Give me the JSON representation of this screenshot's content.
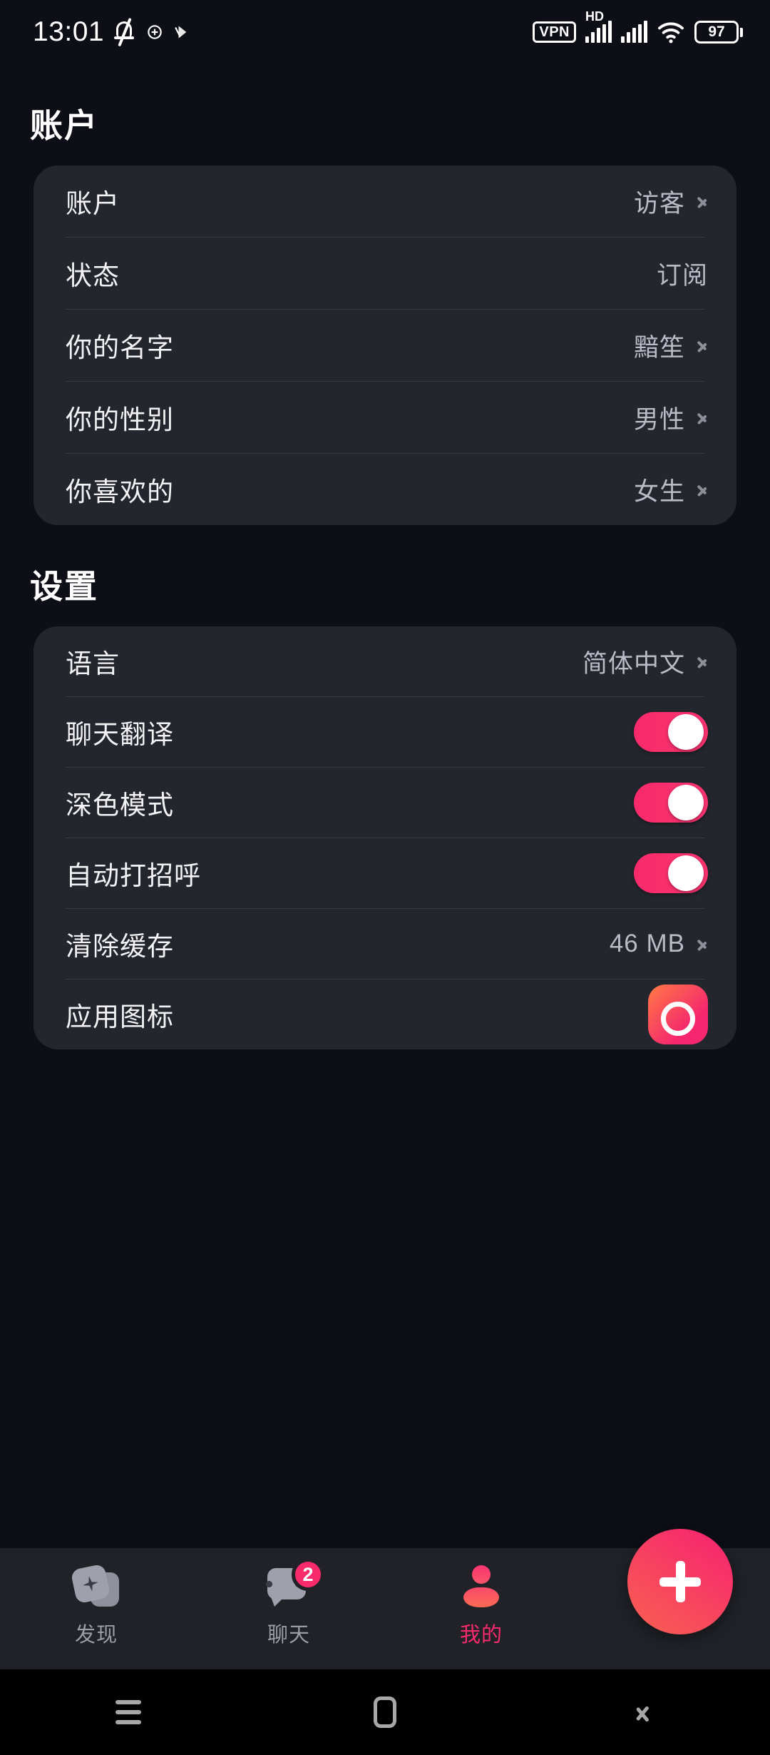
{
  "status_bar": {
    "time": "13:01",
    "icons_left": [
      "notification-mute-icon",
      "app-badge-icon-1",
      "app-badge-icon-2"
    ],
    "vpn_label": "VPN",
    "hd_label": "HD",
    "battery_level": "97",
    "icons_right": [
      "vpn-icon",
      "signal-hd-icon",
      "signal-icon",
      "wifi-icon",
      "battery-icon"
    ]
  },
  "account_section": {
    "title": "账户",
    "rows": [
      {
        "label": "账户",
        "value": "访客",
        "chevron": true,
        "type": "link"
      },
      {
        "label": "状态",
        "value": "订阅",
        "chevron": false,
        "type": "value"
      },
      {
        "label": "你的名字",
        "value": "黯笙",
        "chevron": true,
        "type": "link"
      },
      {
        "label": "你的性别",
        "value": "男性",
        "chevron": true,
        "type": "link"
      },
      {
        "label": "你喜欢的",
        "value": "女生",
        "chevron": true,
        "type": "link"
      }
    ]
  },
  "settings_section": {
    "title": "设置",
    "rows": [
      {
        "label": "语言",
        "value": "简体中文",
        "chevron": true,
        "type": "link"
      },
      {
        "label": "聊天翻译",
        "value": "",
        "chevron": false,
        "type": "toggle",
        "toggle_on": true
      },
      {
        "label": "深色模式",
        "value": "",
        "chevron": false,
        "type": "toggle",
        "toggle_on": true
      },
      {
        "label": "自动打招呼",
        "value": "",
        "chevron": false,
        "type": "toggle",
        "toggle_on": true
      },
      {
        "label": "清除缓存",
        "value": "46 MB",
        "chevron": true,
        "type": "link"
      },
      {
        "label": "应用图标",
        "value": "",
        "chevron": false,
        "type": "app-icon"
      }
    ]
  },
  "tab_bar": {
    "tabs": [
      {
        "label": "发现",
        "icon": "discover-icon",
        "active": false,
        "badge": ""
      },
      {
        "label": "聊天",
        "icon": "chat-icon",
        "active": false,
        "badge": "2"
      },
      {
        "label": "我的",
        "icon": "profile-icon",
        "active": true,
        "badge": ""
      }
    ],
    "fab": {
      "icon": "plus-icon",
      "label": "+"
    }
  },
  "system_nav": {
    "buttons": [
      {
        "name": "recents-button",
        "icon": "menu-icon"
      },
      {
        "name": "home-button",
        "icon": "home-icon"
      },
      {
        "name": "back-button",
        "icon": "back-chevron-icon"
      }
    ]
  },
  "colors": {
    "accent_pink": "#f72a6b",
    "accent_orange": "#f95e52",
    "page_bg": "#0d0e16",
    "card_bg": "#24262e",
    "divider": "#393c45",
    "label": "#f3f3f5",
    "value": "#b9bcc4",
    "tab_inactive": "#9a9da6"
  }
}
